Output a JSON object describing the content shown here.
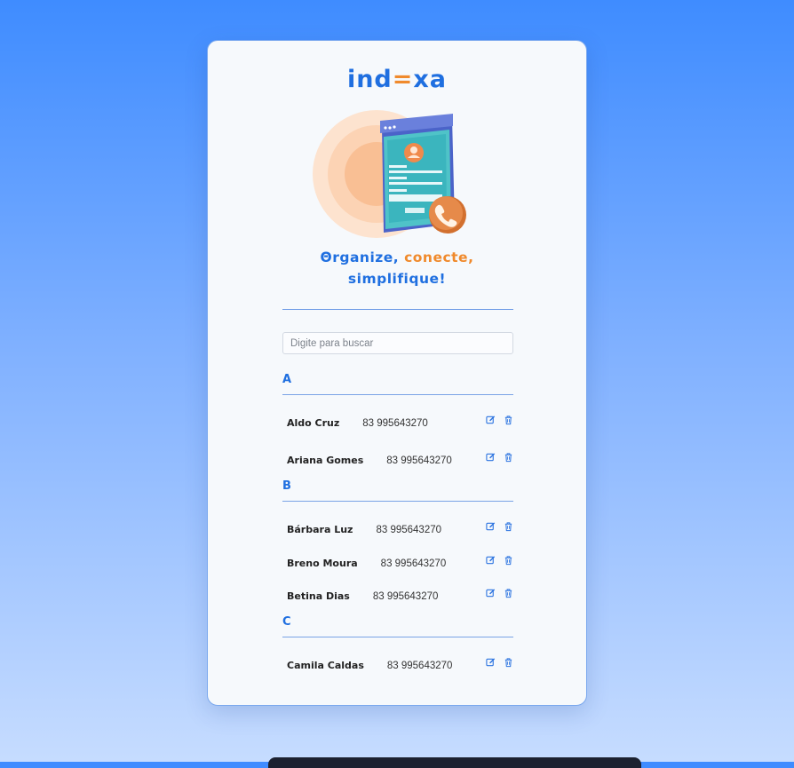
{
  "app": {
    "logo_prefix": "ind",
    "logo_highlight": "=",
    "logo_suffix": "xa",
    "tagline_part1": "Θrganize, ",
    "tagline_part2": "conecte,",
    "tagline_part3": "simplifique!"
  },
  "search": {
    "placeholder": "Digite para buscar",
    "value": ""
  },
  "contacts": [
    {
      "letter": "A",
      "items": [
        {
          "name": "Aldo Cruz",
          "phone": "83 995643270"
        },
        {
          "name": "Ariana Gomes",
          "phone": "83 995643270"
        }
      ]
    },
    {
      "letter": "B",
      "items": [
        {
          "name": "Bárbara Luz",
          "phone": "83 995643270"
        },
        {
          "name": "Breno Moura",
          "phone": "83 995643270"
        },
        {
          "name": "Betina Dias",
          "phone": "83 995643270"
        }
      ]
    },
    {
      "letter": "C",
      "items": [
        {
          "name": "Camila Caldas",
          "phone": "83 995643270"
        }
      ]
    }
  ],
  "icons": {
    "edit": "edit-icon",
    "delete": "trash-icon",
    "illustration": "contact-card-phone-illustration"
  },
  "colors": {
    "primary": "#1f6fe0",
    "accent": "#f08a2c",
    "card_bg": "#f6f9fc"
  }
}
